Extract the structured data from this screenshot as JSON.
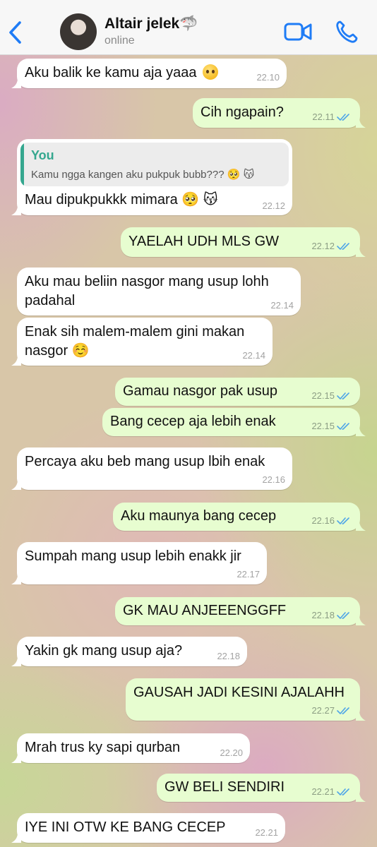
{
  "header": {
    "contact_name": "Altair jelek",
    "name_emoji": "🦈",
    "status": "online"
  },
  "icons": {
    "back": "chevron-left-icon",
    "video": "video-camera-icon",
    "call": "phone-icon",
    "read_receipt": "double-check-icon"
  },
  "colors": {
    "accent": "#1f7cf6",
    "incoming_bubble": "#ffffff",
    "outgoing_bubble": "#e7fdd0",
    "read_ticks": "#4fa5e8",
    "quote_author": "#35a78f"
  },
  "messages": [
    {
      "direction": "in",
      "text": "Aku balik ke kamu aja yaaa",
      "emoji": "🥺",
      "time": "22.10"
    },
    {
      "direction": "out",
      "text": "Cih ngapain?",
      "time": "22.11",
      "read": true
    },
    {
      "direction": "in",
      "reply_to": {
        "author": "You",
        "text": "Kamu ngga kangen aku pukpuk bubb??? 🥺 😽"
      },
      "text": "Mau dipukpukkk mimara 🥺 😽",
      "time": "22.12"
    },
    {
      "direction": "out",
      "text": "YAELAH UDH MLS GW",
      "time": "22.12",
      "read": true
    },
    {
      "direction": "in",
      "text": "Aku mau beliin nasgor mang usup lohh",
      "text2": "padahal",
      "time": "22.14"
    },
    {
      "direction": "in",
      "text": "Enak sih malem-malem gini makan",
      "text2": "nasgor ☺️",
      "time": "22.14"
    },
    {
      "direction": "out",
      "text": "Gamau nasgor pak usup",
      "time": "22.15",
      "read": true
    },
    {
      "direction": "out",
      "text": "Bang cecep aja lebih enak",
      "time": "22.15",
      "read": true
    },
    {
      "direction": "in",
      "text": "Percaya aku beb mang usup lbih enak",
      "time": "22.16"
    },
    {
      "direction": "out",
      "text": "Aku maunya bang cecep",
      "time": "22.16",
      "read": true
    },
    {
      "direction": "in",
      "text": "Sumpah mang usup lebih enakk jir",
      "time": "22.17"
    },
    {
      "direction": "out",
      "text": "GK MAU ANJEEENGGFF",
      "time": "22.18",
      "read": true
    },
    {
      "direction": "in",
      "text": "Yakin gk mang usup aja?",
      "time": "22.18"
    },
    {
      "direction": "out",
      "text": "GAUSAH JADI KESINI AJALAHH",
      "time": "22.27",
      "read": true
    },
    {
      "direction": "in",
      "text": "Mrah trus ky sapi qurban",
      "time": "22.20"
    },
    {
      "direction": "out",
      "text": "GW BELI SENDIRI",
      "time": "22.21",
      "read": true
    },
    {
      "direction": "in",
      "text": "IYE INI OTW KE BANG CECEP",
      "time": "22.21"
    }
  ]
}
